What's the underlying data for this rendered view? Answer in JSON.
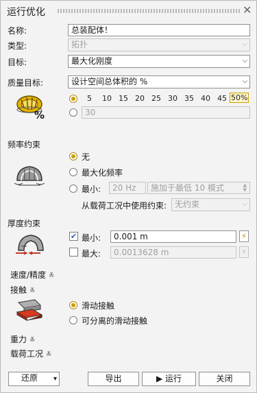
{
  "window": {
    "title": "运行优化"
  },
  "name": {
    "label": "名称:",
    "value": "总装配体！"
  },
  "type": {
    "label": "类型:",
    "value": "拓扑"
  },
  "objective": {
    "label": "目标:",
    "value": "最大化刚度"
  },
  "mass_target": {
    "label": "质量目标:",
    "value": "设计空间总体积的 %",
    "ticks": [
      "5",
      "10",
      "15",
      "20",
      "25",
      "30",
      "35",
      "40",
      "45",
      "50%"
    ],
    "selected_tick": "50%",
    "custom_value": "30",
    "percent_symbol": "%"
  },
  "frequency": {
    "section_label": "频率约束",
    "opt_none": "无",
    "opt_max": "最大化频率",
    "opt_min": "最小:",
    "min_value": "20 Hz",
    "mode_value": "施加于最低 10 模式",
    "loadcase_label": "从载荷工况中使用约束:",
    "loadcase_value": "无约束"
  },
  "thickness": {
    "section_label": "厚度约束",
    "min_label": "最小:",
    "min_value": "0.001 m",
    "max_label": "最大:",
    "max_value": "0.0013628 m"
  },
  "expanders": {
    "speed": "速度/精度",
    "contact": "接触",
    "gravity": "重力",
    "loadcases": "载荷工况"
  },
  "contact": {
    "opt_sliding": "滑动接触",
    "opt_separable": "可分离的滑动接触"
  },
  "footer": {
    "restore": "还原",
    "export": "导出",
    "run": "运行",
    "close": "关闭"
  }
}
